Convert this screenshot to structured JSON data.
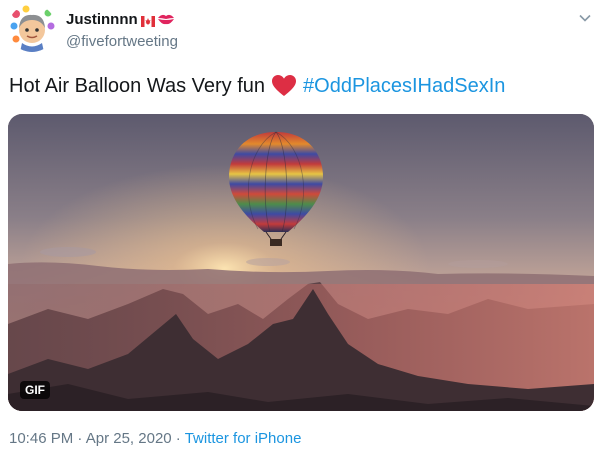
{
  "user": {
    "display_name": "Justinnnn",
    "handle": "@fivefortweeting"
  },
  "tweet": {
    "text_before": "Hot Air Balloon Was Very fun",
    "hashtag": "#OddPlacesIHadSexIn"
  },
  "media": {
    "badge": "GIF"
  },
  "meta": {
    "time": "10:46 PM",
    "separator": " · ",
    "date": "Apr 25, 2020",
    "source": "Twitter for iPhone"
  },
  "colors": {
    "link": "#1b95e0",
    "heart": "#e0245e",
    "secondary_text": "#657786"
  },
  "icons": {
    "menu": "chevron-down-icon",
    "emoji_flag": "canada-flag-icon",
    "emoji_kiss": "kiss-mark-icon",
    "emoji_heart": "red-heart-icon"
  }
}
